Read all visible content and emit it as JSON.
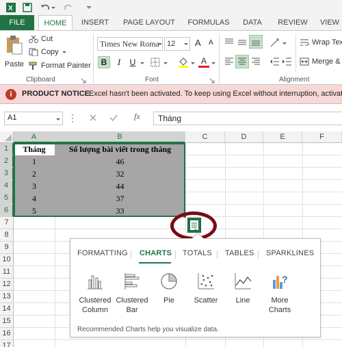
{
  "quick_access": {
    "save_icon": "save-icon",
    "undo_icon": "undo-icon",
    "redo_icon": "redo-icon"
  },
  "tabs": [
    {
      "label": "FILE"
    },
    {
      "label": "HOME"
    },
    {
      "label": "INSERT"
    },
    {
      "label": "PAGE LAYOUT"
    },
    {
      "label": "FORMULAS"
    },
    {
      "label": "DATA"
    },
    {
      "label": "REVIEW"
    },
    {
      "label": "VIEW"
    }
  ],
  "ribbon": {
    "paste_label": "Paste",
    "cut_label": "Cut",
    "copy_label": "Copy",
    "format_painter_label": "Format Painter",
    "clipboard_group": "Clipboard",
    "font_name": "Times New Roma",
    "font_size": "12",
    "font_group": "Font",
    "bold": "B",
    "italic": "I",
    "underline": "U",
    "wrap_text_label": "Wrap Tex",
    "merge_label": "Merge &",
    "alignment_group": "Alignment",
    "grow_font": "A",
    "shrink_font": "A",
    "font_color_letter": "A"
  },
  "notice": {
    "title": "PRODUCT NOTICE",
    "message": "Excel hasn't been activated. To keep using Excel without interruption, activate b"
  },
  "formula_bar": {
    "name_box": "A1",
    "fx": "fx",
    "content": "Tháng"
  },
  "grid": {
    "columns": [
      "A",
      "B",
      "C",
      "D",
      "E",
      "F"
    ],
    "rows": [
      "1",
      "2",
      "3",
      "4",
      "5",
      "6",
      "7",
      "8",
      "9",
      "10",
      "11",
      "12",
      "13",
      "14",
      "15",
      "16",
      "17"
    ],
    "header": {
      "col_a": "Tháng",
      "col_b": "Số lượng bài viết trong tháng"
    },
    "data": [
      {
        "a": "1",
        "b": "46"
      },
      {
        "a": "2",
        "b": "32"
      },
      {
        "a": "3",
        "b": "44"
      },
      {
        "a": "4",
        "b": "37"
      },
      {
        "a": "5",
        "b": "33"
      }
    ]
  },
  "quick_analysis": {
    "tabs": [
      "FORMATTING",
      "CHARTS",
      "TOTALS",
      "TABLES",
      "SPARKLINES"
    ],
    "active_tab": "CHARTS",
    "items": [
      {
        "label_line1": "Clustered",
        "label_line2": "Column",
        "icon": "clustered-column-icon"
      },
      {
        "label_line1": "Clustered",
        "label_line2": "Bar",
        "icon": "clustered-bar-icon"
      },
      {
        "label_line1": "Pie",
        "label_line2": "",
        "icon": "pie-icon"
      },
      {
        "label_line1": "Scatter",
        "label_line2": "",
        "icon": "scatter-icon"
      },
      {
        "label_line1": "Line",
        "label_line2": "",
        "icon": "line-icon"
      },
      {
        "label_line1": "More",
        "label_line2": "Charts",
        "icon": "more-charts-icon"
      }
    ],
    "footer": "Recommended Charts help you visualize data."
  },
  "colors": {
    "excel_green": "#217346",
    "notice_bg": "#f6d8d8",
    "notice_badge": "#c0392b",
    "annotation_circle": "#7a0a18",
    "selection_fill": "#a6a6a6"
  }
}
